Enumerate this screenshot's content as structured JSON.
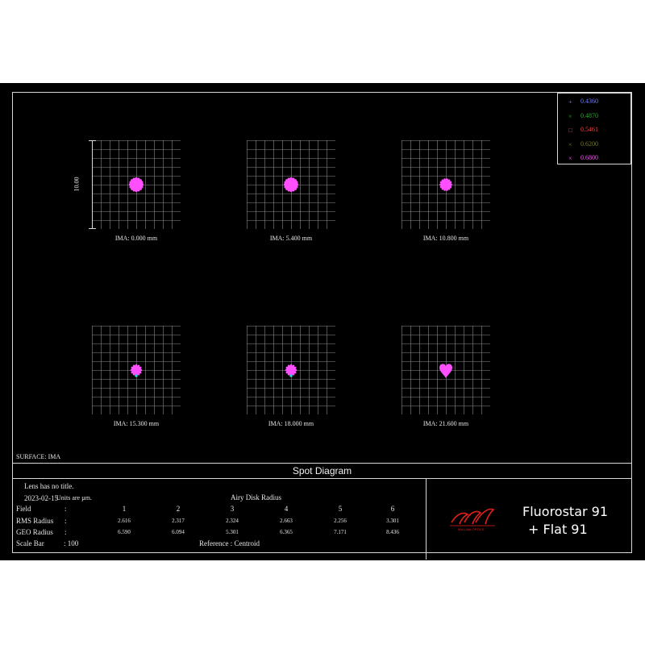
{
  "legend": [
    {
      "mark": "+",
      "value": "0.4360",
      "color": "#6f7dff"
    },
    {
      "mark": "×",
      "value": "0.4870",
      "color": "#2fa52f"
    },
    {
      "mark": "□",
      "value": "0.5461",
      "color": "#ff4040"
    },
    {
      "mark": "×",
      "value": "0.6200",
      "color": "#7a7a28"
    },
    {
      "mark": "×",
      "value": "0.6800",
      "color": "#ff4fff"
    }
  ],
  "scale_label": "10.00",
  "captions": [
    "IMA: 0.000 mm",
    "IMA: 5.400 mm",
    "IMA: 10.800 mm",
    "IMA: 15.300 mm",
    "IMA: 18.000 mm",
    "IMA: 21.600 mm"
  ],
  "surface": "SURFACE: IMA",
  "title": "Spot Diagram",
  "info": {
    "line1": "Lens has no title.",
    "date": "2023-02-15",
    "units": "Units are µm.",
    "airy": "Airy Disk Radius",
    "field_label": "Field",
    "rms_label": "RMS Radius",
    "geo_label": "GEO Radius",
    "scale_label": "Scale Bar",
    "colon": ":",
    "scale_value": ": 100",
    "reference": "Reference   :   Centroid",
    "fields": [
      "1",
      "2",
      "3",
      "4",
      "5",
      "6"
    ],
    "rms": [
      "2.616",
      "2.317",
      "2.324",
      "2.663",
      "2.256",
      "3.301"
    ],
    "geo": [
      "6.590",
      "6.094",
      "5.301",
      "6.365",
      "7.171",
      "8.436"
    ]
  },
  "brand": {
    "logo_text": "WILLIAM OPTICS",
    "line1": "Fluorostar 91",
    "line2": "+  Flat 91",
    "logo_color": "#e02020"
  },
  "spot_color": "#ff4fff"
}
